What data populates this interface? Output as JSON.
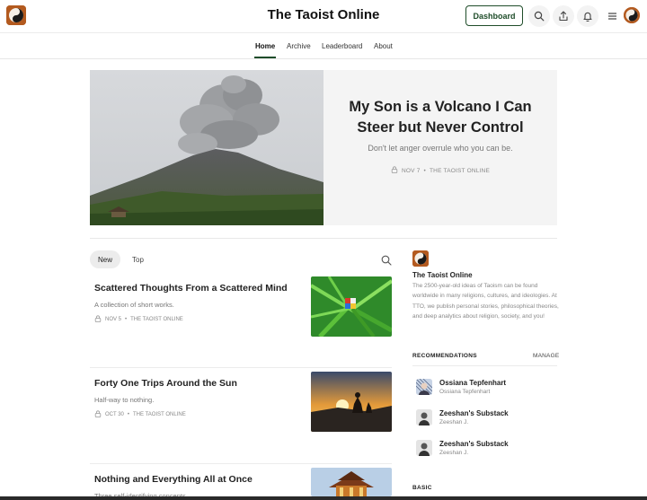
{
  "header": {
    "site_title": "The Taoist Online",
    "dashboard_label": "Dashboard",
    "icons": [
      "search-icon",
      "share-icon",
      "bell-icon",
      "menu-icon"
    ]
  },
  "nav": {
    "items": [
      {
        "label": "Home",
        "active": true
      },
      {
        "label": "Archive",
        "active": false
      },
      {
        "label": "Leaderboard",
        "active": false
      },
      {
        "label": "About",
        "active": false
      }
    ]
  },
  "hero": {
    "title": "My Son is a Volcano I Can Steer but Never Control",
    "subtitle": "Don't let anger overrule who you can be.",
    "date": "NOV 7",
    "publication": "THE TAOIST ONLINE"
  },
  "tabs": {
    "new_label": "New",
    "top_label": "Top"
  },
  "posts": [
    {
      "title": "Scattered Thoughts From a Scattered Mind",
      "subtitle": "A collection of short works.",
      "date": "NOV 5",
      "publication": "THE TAOIST ONLINE"
    },
    {
      "title": "Forty One Trips Around the Sun",
      "subtitle": "Half-way to nothing.",
      "date": "OCT 30",
      "publication": "THE TAOIST ONLINE"
    },
    {
      "title": "Nothing and Everything All at Once",
      "subtitle": "Three self-identifying concepts."
    }
  ],
  "sidebar": {
    "pub_name": "The Taoist Online",
    "pub_description": "The 2500-year-old ideas of Taoism can be found worldwide in many religions, cultures, and ideologies. At TTO, we publish personal stories, philosophical theories, and deep analytics about religion, society, and you!",
    "recommendations_label": "RECOMMENDATIONS",
    "manage_label": "MANAGE",
    "recommendations": [
      {
        "name": "Ossiana Tepfenhart",
        "author": "Ossiana Tepfenhart"
      },
      {
        "name": "Zeeshan's Substack",
        "author": "Zeeshan J."
      },
      {
        "name": "Zeeshan's Substack",
        "author": "Zeeshan J."
      }
    ],
    "basic_label": "BASIC"
  },
  "colors": {
    "accent": "#1f4d2a",
    "logo_bg": "#b35a1f"
  }
}
